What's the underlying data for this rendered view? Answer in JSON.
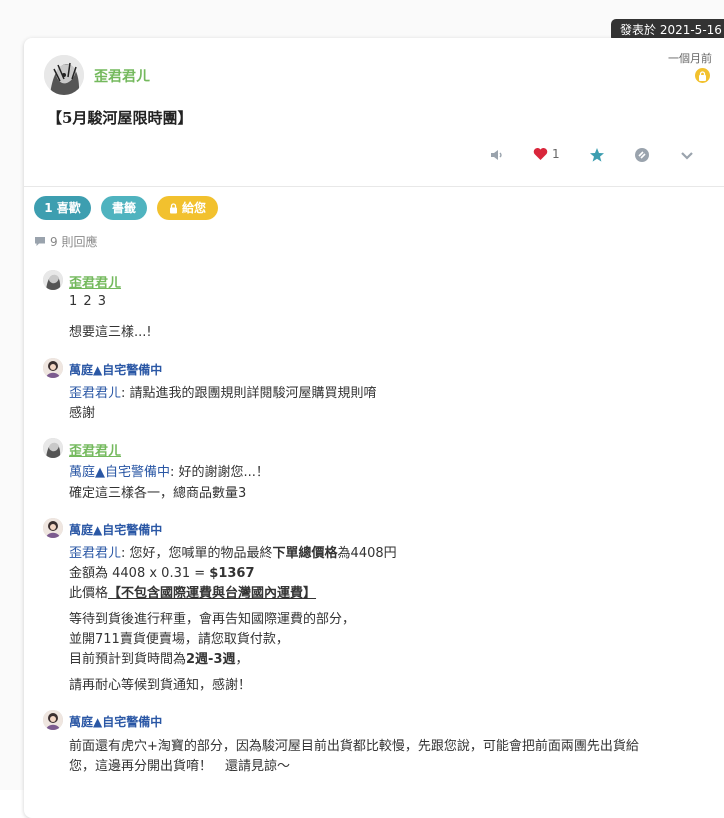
{
  "tooltip": {
    "text": "發表於 2021-5-16"
  },
  "post": {
    "author": "歪君君ㄦ",
    "time": "一個月前",
    "title": "【5月駿河屋限時團】",
    "like_count": "1"
  },
  "tags": [
    {
      "label": "1 喜歡",
      "color": "#3d9eb0"
    },
    {
      "label": "書籤",
      "color": "#4fb3bf"
    },
    {
      "label": "給您",
      "color": "#f2c12e"
    }
  ],
  "replies": {
    "label": "9 則回應"
  },
  "comments": [
    {
      "author": "歪君君ㄦ",
      "lines": [
        "1 2 3",
        "想要這三樣...!"
      ]
    },
    {
      "author": "萬庭▲自宅警備中",
      "mention": "歪君君ㄦ",
      "line1_rest": ": 請點進我的跟團規則詳閱駿河屋購買規則唷",
      "line2": "感謝"
    },
    {
      "author": "歪君君ㄦ",
      "mention": "萬庭▲自宅警備中",
      "line1_rest": ": 好的謝謝您...！",
      "line2": "確定這三樣各一，總商品數量3"
    },
    {
      "author": "萬庭▲自宅警備中",
      "mention": "歪君君ㄦ",
      "l1_a": ": 您好，您喊單的物品最終",
      "l1_b": "下單總價格",
      "l1_c": "為4408円",
      "l2_a": "金額為 4408 x 0.31 = ",
      "l2_b": "$1367",
      "l3_a": "此價格",
      "l3_b": "【不包含國際運費與台灣國內運費】",
      "l4": "等待到貨後進行秤重，會再告知國際運費的部分，",
      "l5": "並開711賣貨便賣場，請您取貨付款，",
      "l6_a": "目前預計到貨時間為",
      "l6_b": "2週-3週",
      "l6_c": "，",
      "l7": "請再耐心等候到貨通知，感謝！"
    },
    {
      "author": "萬庭▲自宅警備中",
      "line1": "前面還有虎穴+淘寶的部分，因為駿河屋目前出貨都比較慢，先跟您說，可能會把前面兩團先出貨給",
      "line2": "您，這邊再分開出貨唷！　還請見諒～"
    }
  ],
  "colors": {
    "green_name": "#74b95d",
    "blue_name": "#2a57a5",
    "heart": "#d9263b",
    "star": "#3d9eb0",
    "lock": "#f2c12e"
  }
}
